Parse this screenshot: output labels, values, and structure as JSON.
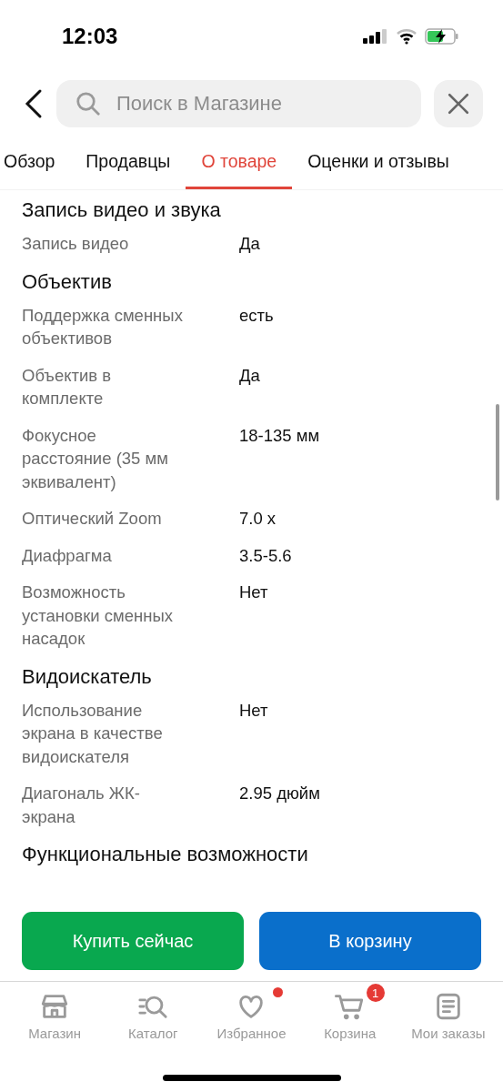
{
  "status_bar": {
    "time": "12:03"
  },
  "search": {
    "placeholder": "Поиск в Магазине"
  },
  "tabs": [
    {
      "label": "Обзор",
      "selected": false
    },
    {
      "label": "Продавцы",
      "selected": false
    },
    {
      "label": "О товаре",
      "selected": true
    },
    {
      "label": "Оценки и отзывы",
      "selected": false
    }
  ],
  "sections": [
    {
      "title": "Запись видео и звука",
      "rows": [
        {
          "label": "Запись видео",
          "value": "Да"
        }
      ]
    },
    {
      "title": "Объектив",
      "rows": [
        {
          "label": "Поддержка сменных объективов",
          "value": "есть"
        },
        {
          "label": "Объектив в комплекте",
          "value": "Да"
        },
        {
          "label": "Фокусное расстояние (35 мм эквивалент)",
          "value": "18-135 мм"
        },
        {
          "label": "Оптический Zoom",
          "value": "7.0 x"
        },
        {
          "label": "Диафрагма",
          "value": "3.5-5.6"
        },
        {
          "label": "Возможность установки сменных насадок",
          "value": "Нет"
        }
      ]
    },
    {
      "title": "Видоискатель",
      "rows": [
        {
          "label": "Использование экрана в качестве видоискателя",
          "value": "Нет"
        },
        {
          "label": "Диагональ ЖК-экрана",
          "value": "2.95 дюйм"
        }
      ]
    },
    {
      "title": "Функциональные возможности"
    }
  ],
  "actions": [
    {
      "label": "Купить сейчас",
      "kind": "buy"
    },
    {
      "label": "В корзину",
      "kind": "cart"
    }
  ],
  "nav": [
    {
      "label": "Магазин",
      "kind": "store"
    },
    {
      "label": "Каталог",
      "kind": "catalog"
    },
    {
      "label": "Избранное",
      "kind": "favorites",
      "dot": true
    },
    {
      "label": "Корзина",
      "kind": "cart",
      "badge": "1"
    },
    {
      "label": "Мои заказы",
      "kind": "orders"
    }
  ]
}
